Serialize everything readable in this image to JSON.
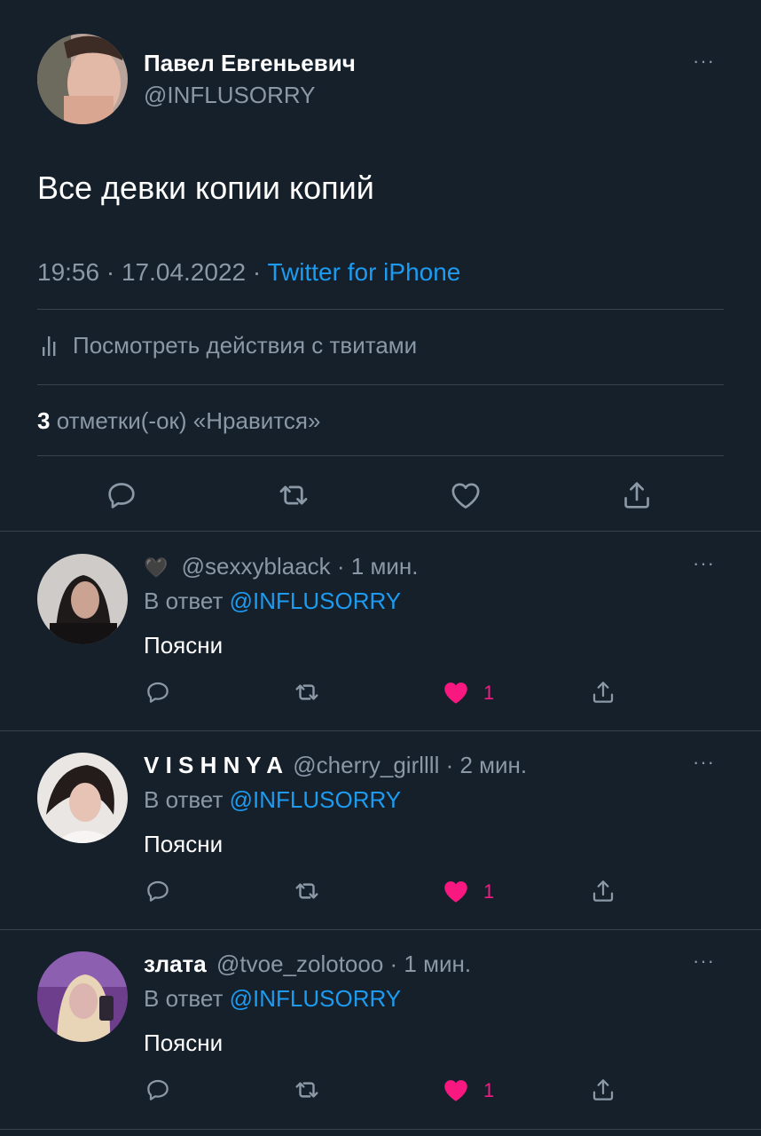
{
  "main_tweet": {
    "display_name": "Павел Евгеньевич",
    "handle": "@INFLUSORRY",
    "text": "Все девки копии копий",
    "time": "19:56 · 17.04.2022 ·",
    "source": "Twitter for iPhone",
    "analytics_label": "Посмотреть действия с твитами",
    "likes_count": "3",
    "likes_label": "отметки(-ок) «Нравится»"
  },
  "replies": [
    {
      "display_name": "",
      "emoji": "🖤",
      "handle": "@sexxyblaack",
      "time": "· 1 мин.",
      "reply_prefix": "В ответ",
      "reply_to": "@INFLUSORRY",
      "text": "Поясни",
      "like_count": "1"
    },
    {
      "display_name": "V I S H N Y A",
      "handle": "@cherry_girllll",
      "time": "· 2 мин.",
      "reply_prefix": "В ответ",
      "reply_to": "@INFLUSORRY",
      "text": "Поясни",
      "like_count": "1"
    },
    {
      "display_name": "злата",
      "handle": "@tvoe_zolotooo",
      "time": "· 1 мин.",
      "reply_prefix": "В ответ",
      "reply_to": "@INFLUSORRY",
      "text": "Поясни",
      "like_count": "1"
    }
  ],
  "more_label": "···",
  "colors": {
    "background": "#15202b",
    "divider": "#38444d",
    "muted": "#8b98a5",
    "link": "#1d9bf0",
    "liked": "#f91880"
  },
  "icons": [
    "reply-icon",
    "retweet-icon",
    "like-icon",
    "share-icon",
    "more-icon",
    "analytics-icon",
    "heart-filled-icon",
    "black-heart-icon"
  ]
}
